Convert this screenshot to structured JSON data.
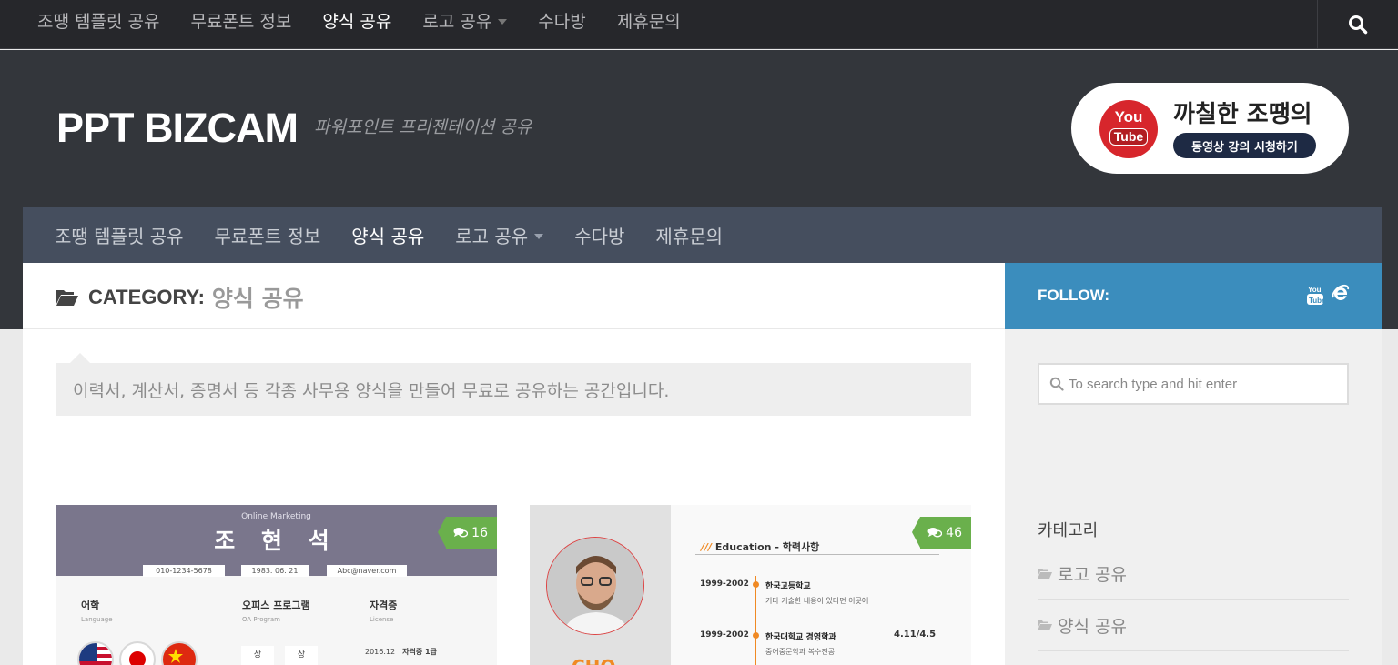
{
  "nav": {
    "items": [
      {
        "label": "조땡 템플릿 공유",
        "active": false,
        "dropdown": false
      },
      {
        "label": "무료폰트 정보",
        "active": false,
        "dropdown": false
      },
      {
        "label": "양식 공유",
        "active": true,
        "dropdown": false
      },
      {
        "label": "로고 공유",
        "active": false,
        "dropdown": true
      },
      {
        "label": "수다방",
        "active": false,
        "dropdown": false
      },
      {
        "label": "제휴문의",
        "active": false,
        "dropdown": false
      }
    ],
    "search_icon": "search-icon"
  },
  "header": {
    "site_title": "PPT BIZCAM",
    "tagline": "파워포인트 프리젠테이션 공유",
    "banner": {
      "logo_line1": "You",
      "logo_line2": "Tube",
      "title": "까칠한 조땡의",
      "button": "동영상 강의 시청하기"
    }
  },
  "category": {
    "prefix": "CATEGORY:",
    "name": "양식 공유",
    "icon": "folder-open-icon",
    "description": "이력서, 계산서, 증명서 등 각종 사무용 양식을 만들어 무료로 공유하는 공간입니다."
  },
  "posts": [
    {
      "comments": "16",
      "resume": {
        "subtitle": "Online Marketing",
        "name": "조 현 석",
        "chips": [
          "010-1234-5678",
          "1983. 06. 21",
          "Abc@naver.com"
        ],
        "sections": [
          {
            "title": "어학",
            "sub": "Language"
          },
          {
            "title": "오피스 프로그램",
            "sub": "OA Program"
          },
          {
            "title": "자격증",
            "sub": "License"
          }
        ],
        "levels": [
          "상",
          "상"
        ],
        "license_row": {
          "date": "2016.12",
          "text": "자격증 1급"
        }
      }
    },
    {
      "comments": "46",
      "resume": {
        "edu_prefix": "///",
        "edu_title": "Education - 학력사항",
        "rows": [
          {
            "years": "1999-2002",
            "title": "한국고등학교",
            "desc": "기타 기술한 내용이 있다면 이곳에",
            "gpa": ""
          },
          {
            "years": "1999-2002",
            "title": "한국대학교 경영학과",
            "desc": "중어중문학과 복수전공",
            "gpa": "4.11/4.5"
          }
        ],
        "name_partial": "CHO"
      }
    }
  ],
  "sidebar": {
    "follow_label": "FOLLOW:",
    "follow_icons": [
      "youtube-icon",
      "internet-explorer-icon"
    ],
    "search_placeholder": "To search type and hit enter",
    "categories_heading": "카테고리",
    "categories": [
      "로고 공유",
      "양식 공유"
    ]
  },
  "colors": {
    "topbar": "#26272b",
    "header": "#33363b",
    "nav2": "#454e5e",
    "follow": "#3b8dbd",
    "comment_badge": "#6ab04c",
    "accent_orange": "#f08a24"
  }
}
